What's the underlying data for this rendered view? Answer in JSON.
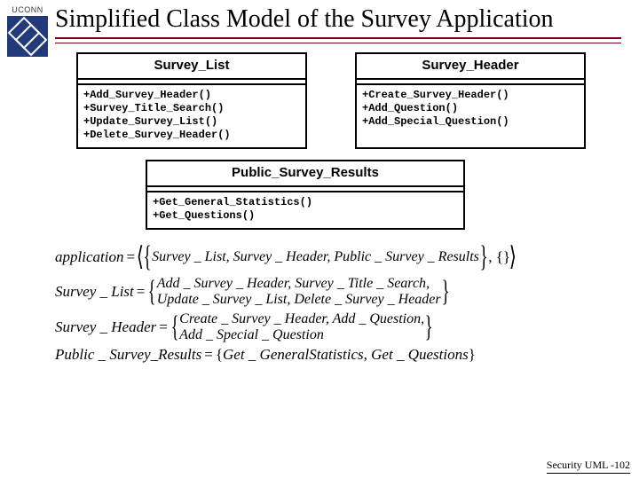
{
  "header": {
    "org": "UCONN",
    "title": "Simplified Class Model of the Survey Application"
  },
  "classes": {
    "survey_list": {
      "name": "Survey_List",
      "ops": "+Add_Survey_Header()\n+Survey_Title_Search()\n+Update_Survey_List()\n+Delete_Survey_Header()"
    },
    "survey_header": {
      "name": "Survey_Header",
      "ops": "+Create_Survey_Header()\n+Add_Question()\n+Add_Special_Question()"
    },
    "public_survey_results": {
      "name": "Public_Survey_Results",
      "ops": "+Get_General_Statistics()\n+Get_Questions()"
    }
  },
  "formulas": {
    "app_lhs": "application",
    "app_set_line": "Survey _ List, Survey _ Header, Public _ Survey _ Results",
    "app_tail": ", {}",
    "sl_lhs": "Survey _ List",
    "sl_line1": "Add _ Survey _ Header, Survey _ Title _ Search,",
    "sl_line2": "Update _ Survey _ List, Delete _ Survey _ Header",
    "sh_lhs": "Survey _ Header",
    "sh_line1": "Create _ Survey _ Header, Add _ Question,",
    "sh_line2": "Add _ Special _ Question",
    "psr_lhs": "Public _ Survey_Results",
    "psr_rhs": "Get _ GeneralStatistics, Get _ Questions"
  },
  "footer": {
    "text": "Security UML -102"
  }
}
